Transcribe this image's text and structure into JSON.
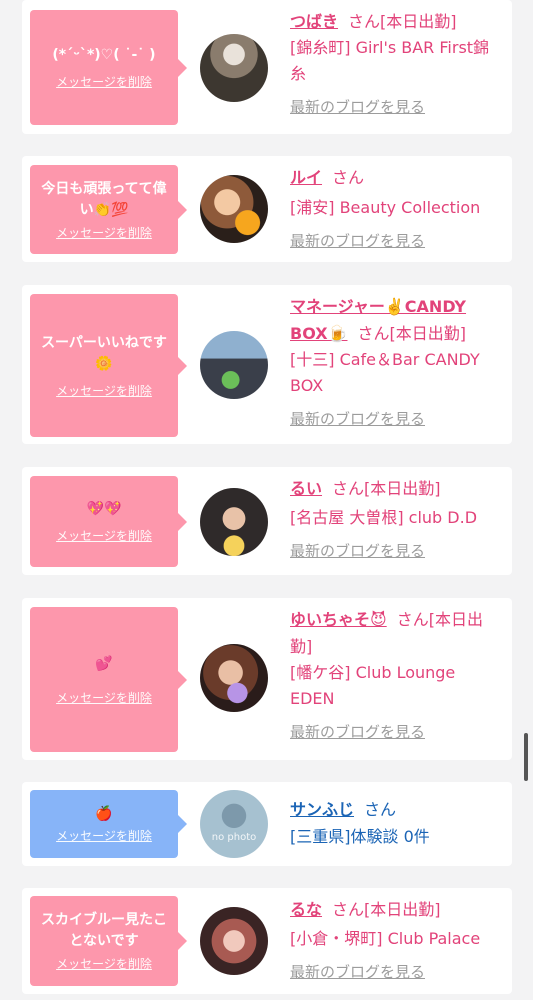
{
  "delete_label": "メッセージを削除",
  "san_label": "さん",
  "blog_label": "最新のブログを見る",
  "colors": {
    "pink_bubble": "#fd97ac",
    "blue_bubble": "#87b4f8",
    "pink_text": "#e2437a",
    "blue_text": "#1b64b5"
  },
  "cards": [
    {
      "message": "(*ˊᵕˋ*)♡( ˙-˙ )",
      "name": "つばき",
      "status": "[本日出勤]",
      "shop": "[錦糸町] Girl's BAR First錦糸",
      "bubble_color": "pink",
      "avatar_icon": "cast-photo"
    },
    {
      "message": "今日も頑張ってて偉い👏💯",
      "name": "ルイ",
      "status": "",
      "shop": "[浦安] Beauty Collection",
      "bubble_color": "pink",
      "avatar_icon": "cast-photo"
    },
    {
      "message": "スーパーいいねです🌼",
      "name": "マネージャー✌️CANDY BOX🍺",
      "status": "[本日出勤]",
      "shop": "[十三] Cafe＆Bar CANDY BOX",
      "bubble_color": "pink",
      "avatar_icon": "cast-photo"
    },
    {
      "message": "💖💖",
      "name": "るい",
      "status": "[本日出勤]",
      "shop": "[名古屋 大曽根] club D.D",
      "bubble_color": "pink",
      "avatar_icon": "cast-photo"
    },
    {
      "message": "💕",
      "name": "ゆいちゃそ😈",
      "status": "[本日出勤]",
      "shop": "[幡ケ谷] Club Lounge EDEN",
      "bubble_color": "pink",
      "avatar_icon": "cast-photo"
    },
    {
      "message": "🍎",
      "name": "サンふじ",
      "status": "",
      "shop": "[三重県]体験談 0件",
      "bubble_color": "blue",
      "avatar_icon": "no-photo",
      "avatar_text": "no photo"
    },
    {
      "message": "スカイブルー見たことないです",
      "name": "るな",
      "status": "[本日出勤]",
      "shop": "[小倉・堺町] Club Palace",
      "bubble_color": "pink",
      "avatar_icon": "cast-photo"
    }
  ]
}
